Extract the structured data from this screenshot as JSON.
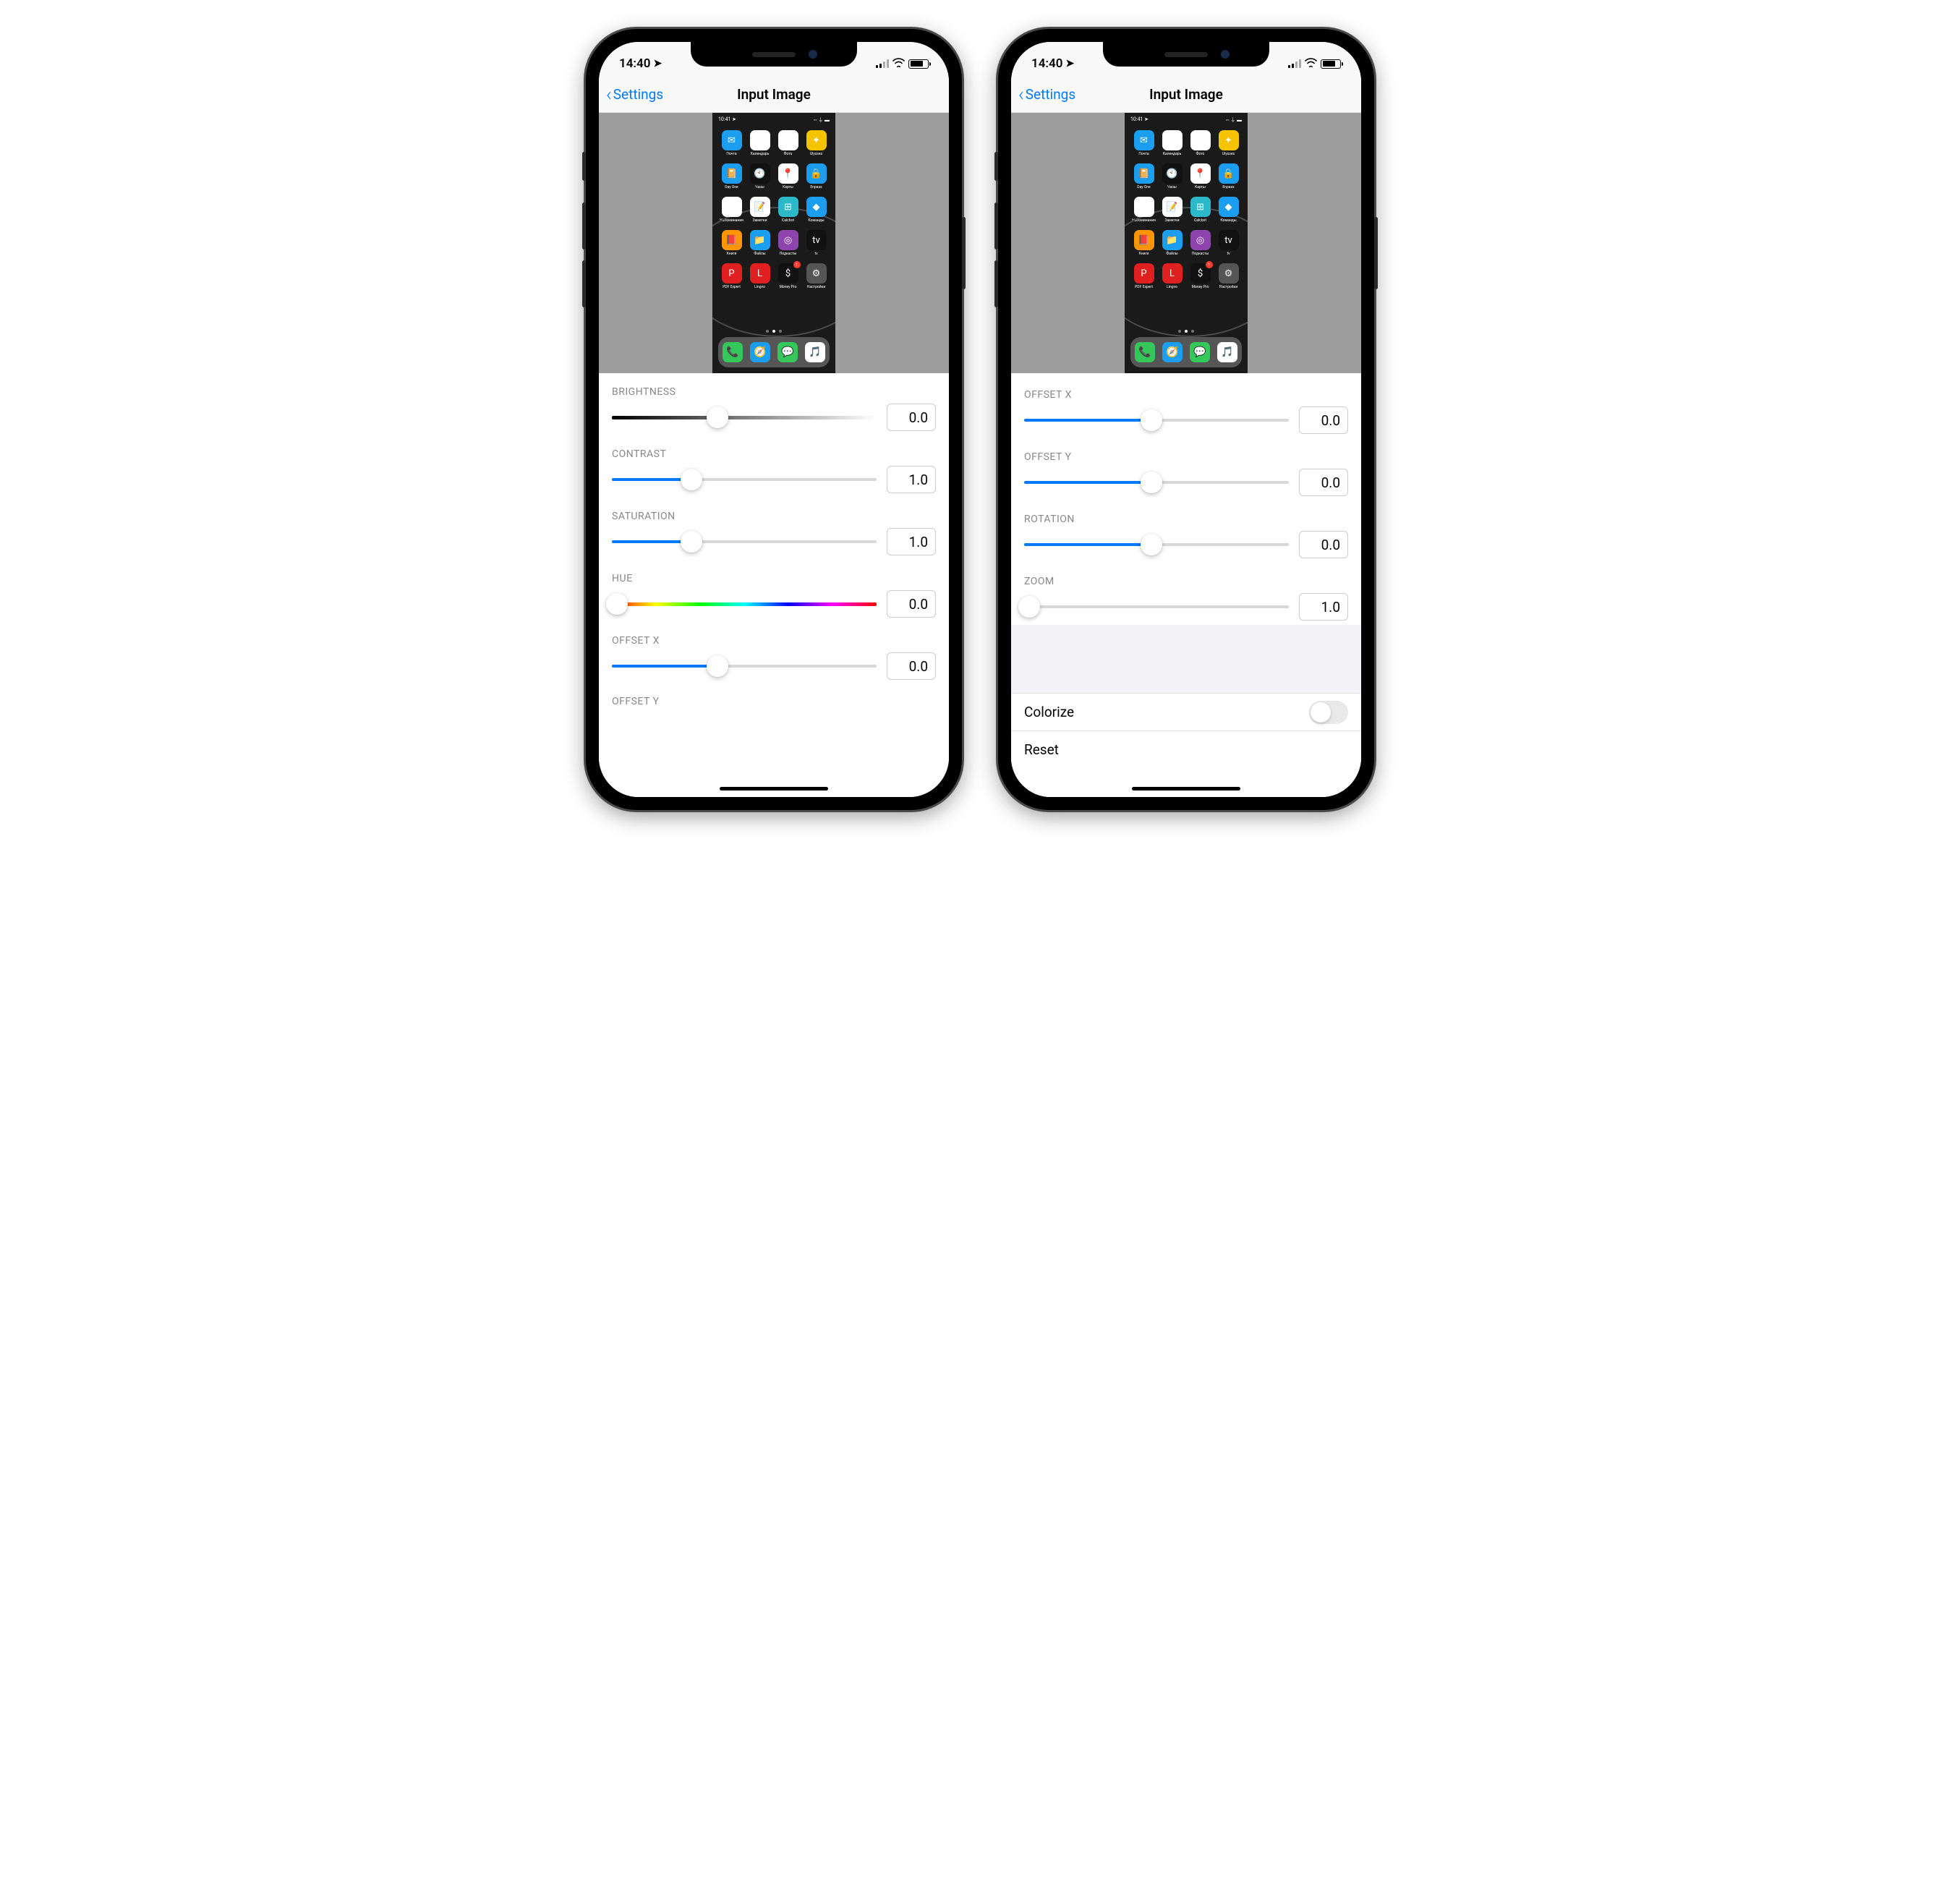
{
  "status": {
    "time": "14:40"
  },
  "nav": {
    "back": "Settings",
    "title": "Input Image"
  },
  "preview": {
    "mini_time": "10:41",
    "dots": 3,
    "apps": [
      {
        "label": "Почта",
        "color": "ico-blue",
        "glyph": "✉"
      },
      {
        "label": "Календарь",
        "color": "ico-white",
        "glyph": "30"
      },
      {
        "label": "Фото",
        "color": "ico-white",
        "glyph": "✿"
      },
      {
        "label": "Ulysses",
        "color": "ico-yellow",
        "glyph": "✦"
      },
      {
        "label": "Day One",
        "color": "ico-blue",
        "glyph": "📔"
      },
      {
        "label": "Часы",
        "color": "ico-black",
        "glyph": "🕙"
      },
      {
        "label": "Карты",
        "color": "ico-white",
        "glyph": "📍"
      },
      {
        "label": "Enpass",
        "color": "ico-blue",
        "glyph": "🔒"
      },
      {
        "label": "Напоминания",
        "color": "ico-white",
        "glyph": "≡"
      },
      {
        "label": "Заметки",
        "color": "ico-white",
        "glyph": "📝"
      },
      {
        "label": "Calcbot",
        "color": "ico-teal",
        "glyph": "⊞"
      },
      {
        "label": "Команды",
        "color": "ico-blue",
        "glyph": "◆"
      },
      {
        "label": "Книги",
        "color": "ico-orange",
        "glyph": "📕"
      },
      {
        "label": "Файлы",
        "color": "ico-blue",
        "glyph": "📁"
      },
      {
        "label": "Подкасты",
        "color": "ico-purple",
        "glyph": "◎"
      },
      {
        "label": "tv",
        "color": "ico-black",
        "glyph": "tv"
      },
      {
        "label": "PDF Expert",
        "color": "ico-red",
        "glyph": "P"
      },
      {
        "label": "Lingvo",
        "color": "ico-red",
        "glyph": "L"
      },
      {
        "label": "Money Pro",
        "color": "ico-black",
        "glyph": "$",
        "badge": "1"
      },
      {
        "label": "Настройки",
        "color": "ico-grey",
        "glyph": "⚙"
      }
    ],
    "dock": [
      {
        "color": "ico-green",
        "glyph": "📞"
      },
      {
        "color": "ico-blue",
        "glyph": "🧭"
      },
      {
        "color": "ico-green",
        "glyph": "💬"
      },
      {
        "color": "ico-white",
        "glyph": "🎵"
      }
    ]
  },
  "sliders_a": [
    {
      "label": "BRIGHTNESS",
      "value": "0.0",
      "percent": 40,
      "track": "bw"
    },
    {
      "label": "CONTRAST",
      "value": "1.0",
      "percent": 30,
      "track": "blue"
    },
    {
      "label": "SATURATION",
      "value": "1.0",
      "percent": 30,
      "track": "blue"
    },
    {
      "label": "HUE",
      "value": "0.0",
      "percent": 2,
      "track": "hue"
    },
    {
      "label": "OFFSET X",
      "value": "0.0",
      "percent": 40,
      "track": "blue"
    }
  ],
  "partial_label_a": "OFFSET Y",
  "sliders_b": [
    {
      "label": "OFFSET X",
      "value": "0.0",
      "percent": 48,
      "track": "blue"
    },
    {
      "label": "OFFSET Y",
      "value": "0.0",
      "percent": 48,
      "track": "blue"
    },
    {
      "label": "ROTATION",
      "value": "0.0",
      "percent": 48,
      "track": "blue"
    },
    {
      "label": "ZOOM",
      "value": "1.0",
      "percent": 2,
      "track": "blue"
    }
  ],
  "rows": {
    "colorize": "Colorize",
    "reset": "Reset",
    "colorize_on": false
  }
}
